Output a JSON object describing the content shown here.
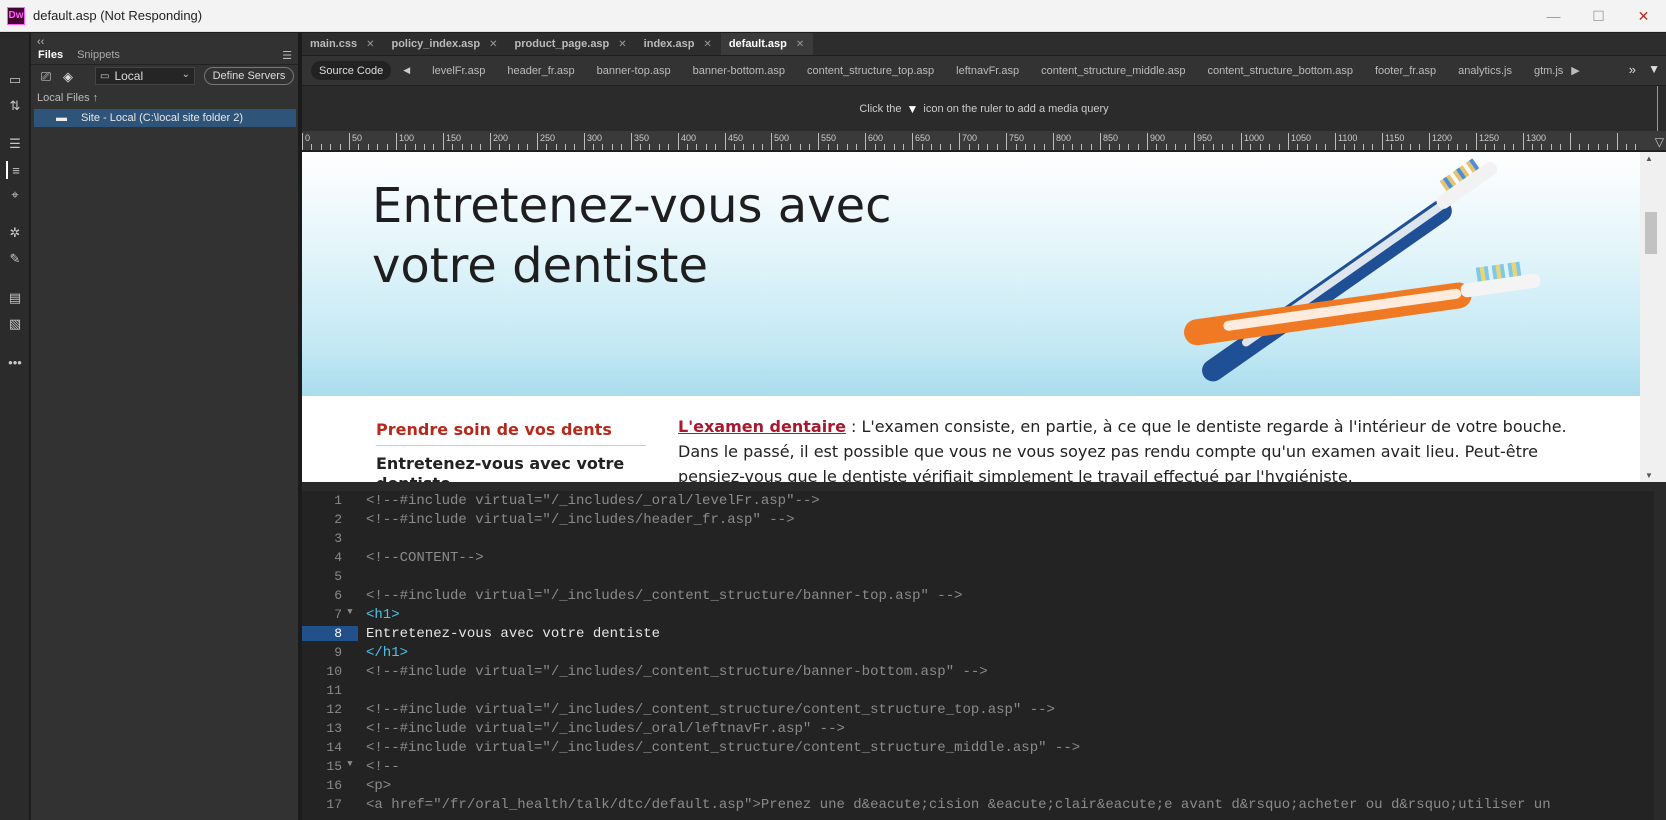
{
  "window": {
    "app_logo": "Dw",
    "title": "default.asp (Not Responding)",
    "controls": [
      "—",
      "☐",
      "✕"
    ]
  },
  "left_toolbar": {
    "icons": [
      "file-icon",
      "sync-icon",
      "properties-icon",
      "dom-icon",
      "insert-icon",
      "css-designer-icon",
      "assets-icon",
      "comments-icon",
      "validation-icon",
      "more-icon"
    ]
  },
  "files_panel": {
    "collapse": "‹‹",
    "tabs": [
      {
        "label": "Files",
        "active": true
      },
      {
        "label": "Snippets",
        "active": false
      }
    ],
    "site_select": "Local",
    "define_servers": "Define Servers",
    "local_files_label": "Local Files ↑",
    "site_item": "Site - Local (C:\\local site folder 2)"
  },
  "doc_tabs": [
    {
      "label": "main.css",
      "active": false
    },
    {
      "label": "policy_index.asp",
      "active": false
    },
    {
      "label": "product_page.asp",
      "active": false
    },
    {
      "label": "index.asp",
      "active": false
    },
    {
      "label": "default.asp",
      "active": true
    }
  ],
  "related_files": {
    "source_code": "Source Code",
    "files": [
      "levelFr.asp",
      "header_fr.asp",
      "banner-top.asp",
      "banner-bottom.asp",
      "content_structure_top.asp",
      "leftnavFr.asp",
      "content_structure_middle.asp",
      "content_structure_bottom.asp",
      "footer_fr.asp",
      "analytics.js",
      "gtm.js"
    ]
  },
  "media_query_bar": {
    "prefix": "Click the",
    "suffix": "icon on the ruler to add a media query"
  },
  "ruler": {
    "labels": [
      "0",
      "50",
      "100",
      "150",
      "200",
      "250",
      "300",
      "350",
      "400",
      "450",
      "500",
      "550",
      "600",
      "650",
      "700",
      "750",
      "800",
      "850",
      "900",
      "950",
      "1000",
      "1050",
      "1100",
      "1150",
      "1200",
      "1250",
      "1300"
    ]
  },
  "live_view": {
    "heading": "Entretenez-vous avec votre dentiste",
    "nav_title": "Prendre soin de vos dents",
    "nav_item": "Entretenez-vous avec votre dentiste",
    "content_link": "L'examen dentaire",
    "content_text": " : L'examen consiste, en partie, à ce que le dentiste regarde à l'intérieur de votre bouche. Dans le passé, il est possible que vous ne vous soyez pas rendu compte qu'un examen avait lieu. Peut-être pensiez-vous que le dentiste vérifiait simplement le travail effectué par l'hygiéniste."
  },
  "code": {
    "current_line": 8,
    "lines": [
      {
        "n": "1",
        "fold": "",
        "kind": "c-comment",
        "text": "<!--#include virtual=\"/_includes/_oral/levelFr.asp\"-->"
      },
      {
        "n": "2",
        "fold": "",
        "kind": "c-comment",
        "text": "<!--#include virtual=\"/_includes/header_fr.asp\" -->"
      },
      {
        "n": "3",
        "fold": "",
        "kind": "c-comment",
        "text": ""
      },
      {
        "n": "4",
        "fold": "",
        "kind": "c-comment",
        "text": "<!--CONTENT-->"
      },
      {
        "n": "5",
        "fold": "",
        "kind": "c-comment",
        "text": ""
      },
      {
        "n": "6",
        "fold": "",
        "kind": "c-comment",
        "text": "<!--#include virtual=\"/_includes/_content_structure/banner-top.asp\" -->"
      },
      {
        "n": "7",
        "fold": "▼",
        "kind": "c-tag",
        "text": "<h1>"
      },
      {
        "n": "8",
        "fold": "",
        "kind": "c-text",
        "text": "Entretenez-vous avec votre dentiste"
      },
      {
        "n": "9",
        "fold": "",
        "kind": "c-tag",
        "text": "</h1>"
      },
      {
        "n": "10",
        "fold": "",
        "kind": "c-comment",
        "text": "<!--#include virtual=\"/_includes/_content_structure/banner-bottom.asp\" -->"
      },
      {
        "n": "11",
        "fold": "",
        "kind": "c-comment",
        "text": ""
      },
      {
        "n": "12",
        "fold": "",
        "kind": "c-comment",
        "text": "<!--#include virtual=\"/_includes/_content_structure/content_structure_top.asp\" -->"
      },
      {
        "n": "13",
        "fold": "",
        "kind": "c-comment",
        "text": "<!--#include virtual=\"/_includes/_oral/leftnavFr.asp\" -->"
      },
      {
        "n": "14",
        "fold": "",
        "kind": "c-comment",
        "text": "<!--#include virtual=\"/_includes/_content_structure/content_structure_middle.asp\" -->"
      },
      {
        "n": "15",
        "fold": "▼",
        "kind": "c-comment",
        "text": "<!--"
      },
      {
        "n": "16",
        "fold": "",
        "kind": "c-comment",
        "text": "<p>"
      },
      {
        "n": "17",
        "fold": "",
        "kind": "c-comment",
        "text": "<a href=\"/fr/oral_health/talk/dtc/default.asp\">Prenez une d&eacute;cision &eacute;clair&eacute;e avant d&rsquo;acheter ou d&rsquo;utiliser un"
      }
    ]
  },
  "colors": {
    "accent_selection": "#22508a",
    "link_red": "#a6192e",
    "tag_cyan": "#4fc1e9"
  }
}
